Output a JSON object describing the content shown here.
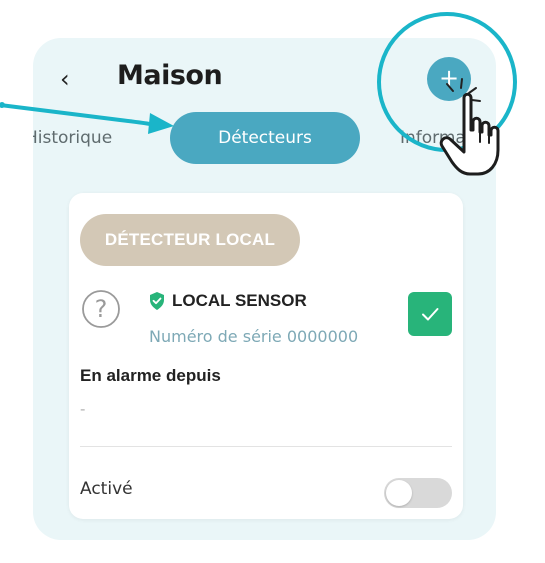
{
  "header": {
    "title": "Maison",
    "back_icon": "chevron-left-icon",
    "add_label": "+"
  },
  "tabs": {
    "historique": "Historique",
    "detecteurs": "Détecteurs",
    "informations": "Informations"
  },
  "card": {
    "chip": "DÉTECTEUR LOCAL",
    "sensor_name": "LOCAL SENSOR",
    "serial": "Numéro de série 0000000",
    "alarm_label": "En alarme depuis",
    "alarm_value": "-",
    "active_label": "Activé",
    "checked": true,
    "active_toggle_on": false
  },
  "colors": {
    "accent": "#4aa8c1",
    "annotation": "#1ab5c9",
    "panel_bg": "#eaf6f8",
    "chip_bg": "#d3c8b6",
    "check_green": "#28b47a"
  }
}
